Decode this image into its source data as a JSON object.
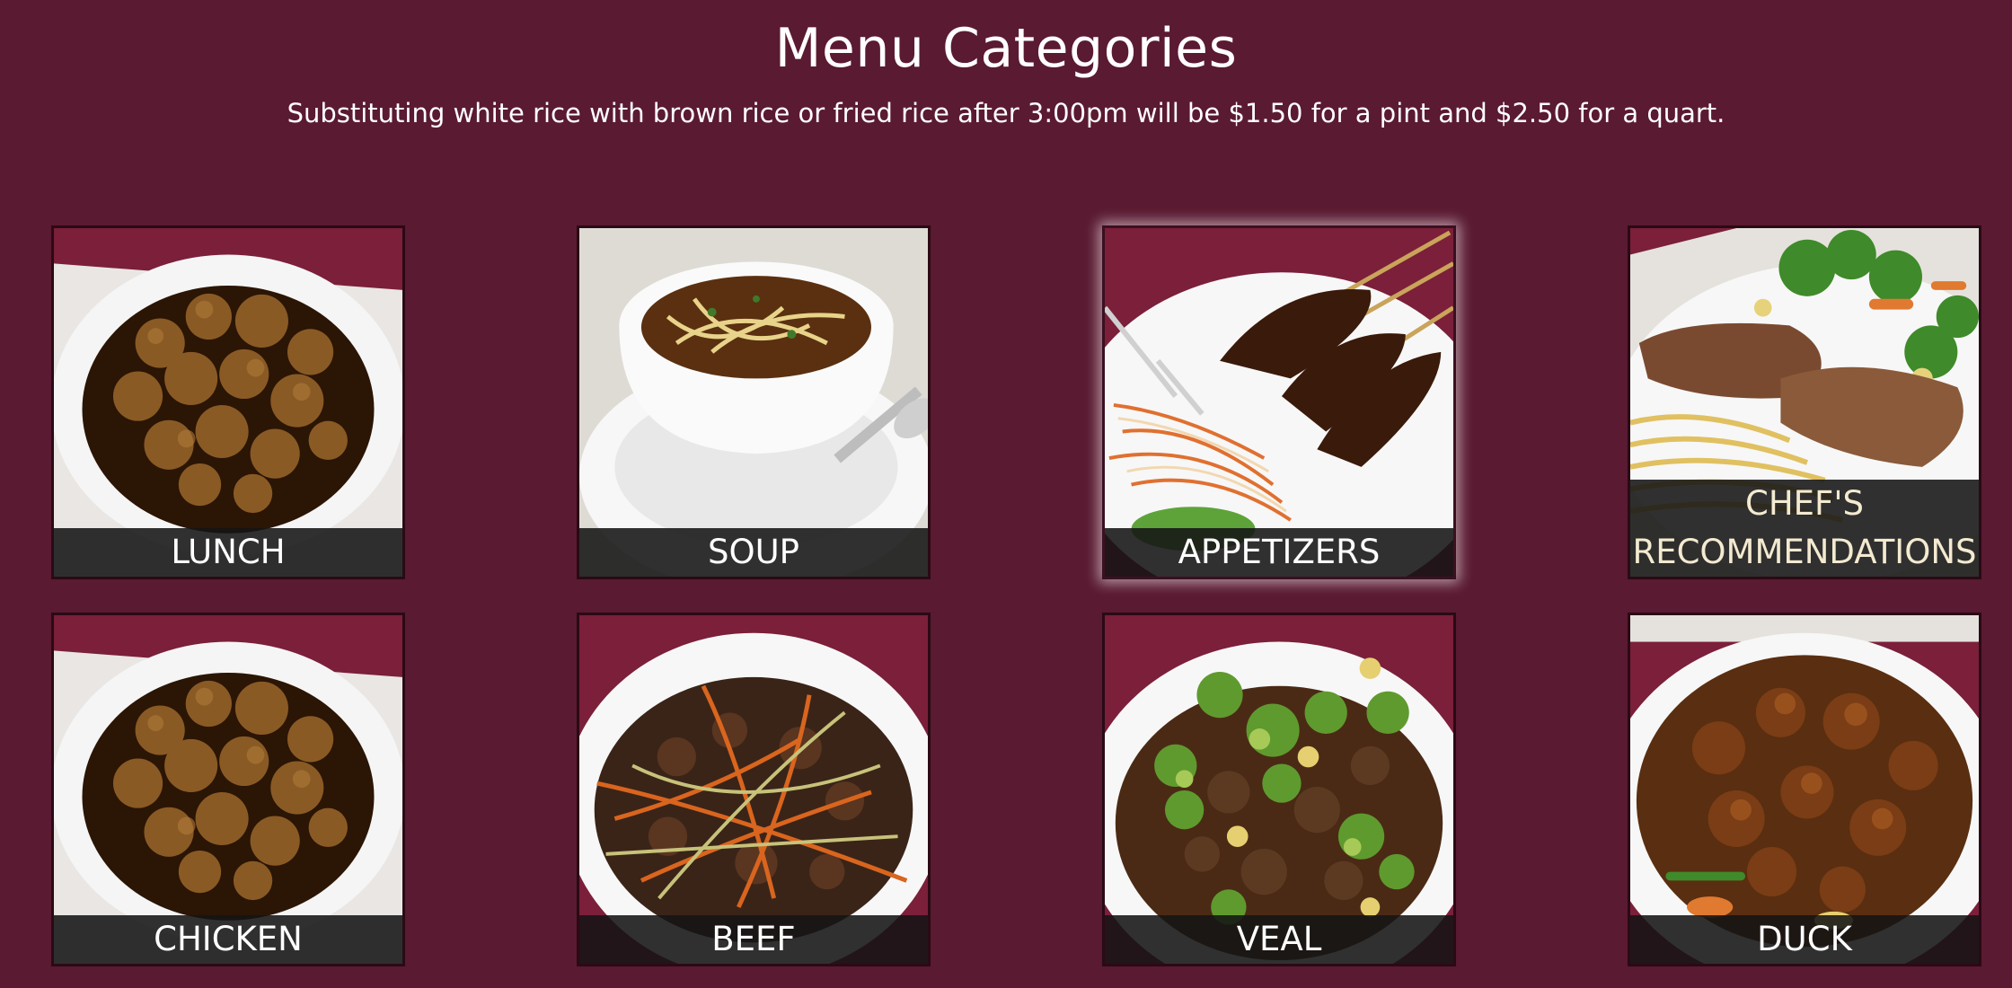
{
  "header": {
    "title": "Menu Categories",
    "subtitle": "Substituting white rice with brown rice or fried rice after 3:00pm will be $1.50 for a pint and $2.50 for a quart."
  },
  "categories": [
    {
      "label": "LUNCH",
      "photo": "sesame-chicken-icon"
    },
    {
      "label": "SOUP",
      "photo": "noodle-soup-icon"
    },
    {
      "label": "APPETIZERS",
      "photo": "beef-skewers-icon",
      "selected": true
    },
    {
      "label_line1": "CHEF'S",
      "label_line2": "RECOMMENDATIONS",
      "photo": "steak-noodles-icon"
    },
    {
      "label": "CHICKEN",
      "photo": "sesame-chicken-icon"
    },
    {
      "label": "BEEF",
      "photo": "shredded-beef-icon"
    },
    {
      "label": "VEAL",
      "photo": "veal-broccoli-icon"
    },
    {
      "label": "DUCK",
      "photo": "roast-duck-icon"
    }
  ],
  "colors": {
    "background": "#5a1a31",
    "caption_bar": "#141414",
    "plate": "#f2f2f2"
  }
}
